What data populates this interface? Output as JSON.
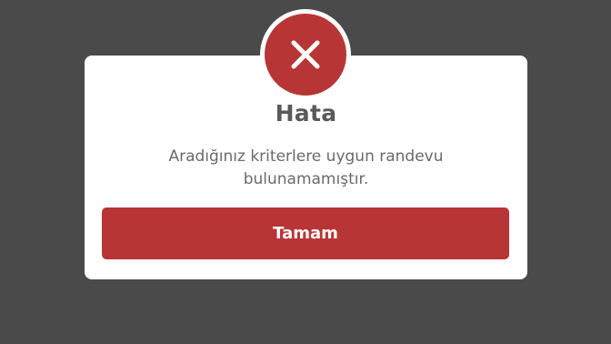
{
  "dialog": {
    "icon": "close-icon",
    "title": "Hata",
    "message": "Aradığınız kriterlere uygun randevu bulunamamıştır.",
    "confirm_label": "Tamam"
  },
  "colors": {
    "backdrop": "#4a4a4a",
    "accent": "#b83535",
    "title_text": "#5a5a5a",
    "message_text": "#6a6a6a"
  }
}
